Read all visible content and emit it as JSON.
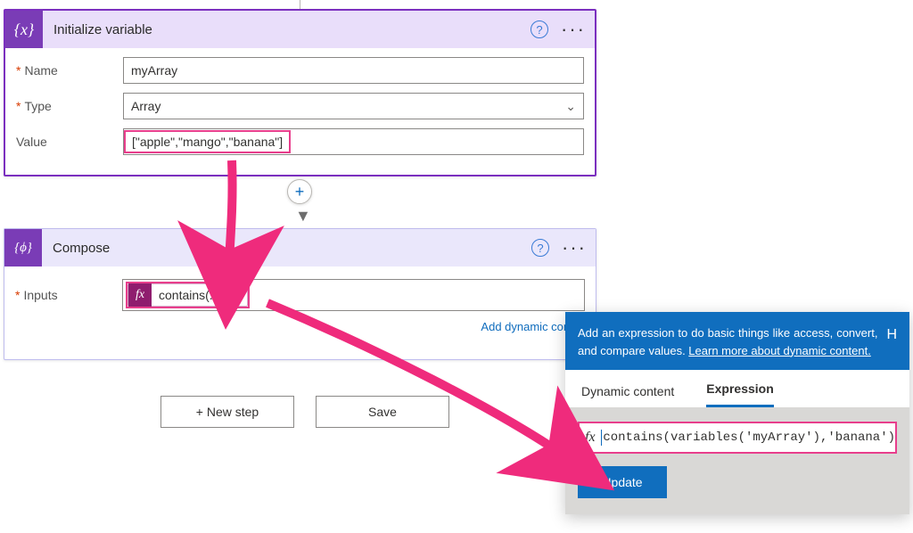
{
  "card1": {
    "title": "Initialize variable",
    "labels": {
      "name": "Name",
      "type": "Type",
      "value": "Value"
    },
    "name_value": "myArray",
    "type_value": "Array",
    "value_value": "[\"apple\",\"mango\",\"banana\"]"
  },
  "card2": {
    "title": "Compose",
    "labels": {
      "inputs": "Inputs"
    },
    "token_label": "contains(...)",
    "add_dynamic": "Add dynamic conte"
  },
  "footer": {
    "new_step": "+ New step",
    "save": "Save"
  },
  "popup": {
    "help_text_1": "Add an expression to do basic things like access, convert, and compare values. ",
    "help_link": "Learn more about dynamic content.",
    "hide_btn": "H",
    "tabs": {
      "dynamic": "Dynamic content",
      "expression": "Expression"
    },
    "fx_label": "fx",
    "expr_value": "contains(variables('myArray'),'banana')",
    "update": "Update"
  },
  "icons": {
    "help": "?",
    "more": "···",
    "plus": "+",
    "arrow_down": "▼",
    "chevron_down": "⌄",
    "close_x": "✕",
    "curly": "{x}",
    "fx": "fx",
    "compose_icon": "{ϕ}"
  }
}
